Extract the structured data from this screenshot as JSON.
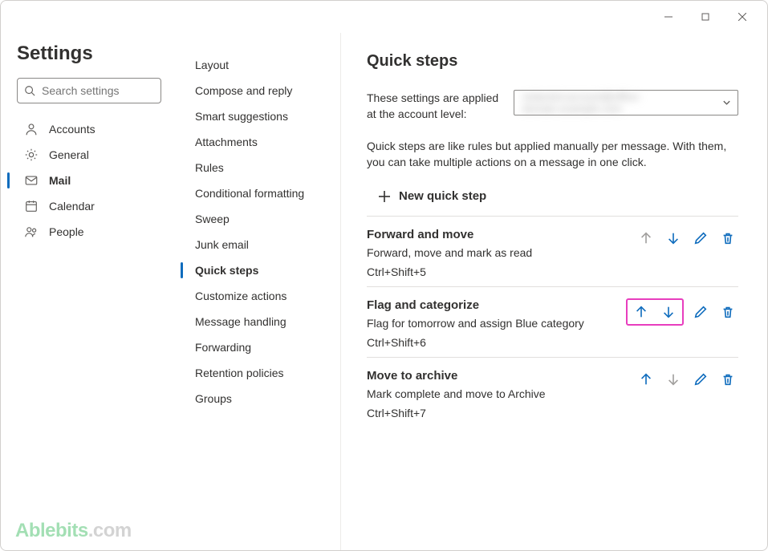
{
  "window": {
    "minimize": "Minimize",
    "maximize": "Maximize",
    "close": "Close"
  },
  "leftCol": {
    "title": "Settings",
    "searchPlaceholder": "Search settings",
    "nav": [
      {
        "key": "accounts",
        "label": "Accounts",
        "icon": "person"
      },
      {
        "key": "general",
        "label": "General",
        "icon": "gear"
      },
      {
        "key": "mail",
        "label": "Mail",
        "icon": "mail",
        "selected": true
      },
      {
        "key": "calendar",
        "label": "Calendar",
        "icon": "calendar"
      },
      {
        "key": "people",
        "label": "People",
        "icon": "people"
      }
    ]
  },
  "midCol": {
    "items": [
      "Layout",
      "Compose and reply",
      "Smart suggestions",
      "Attachments",
      "Rules",
      "Conditional formatting",
      "Sweep",
      "Junk email",
      "Quick steps",
      "Customize actions",
      "Message handling",
      "Forwarding",
      "Retention policies",
      "Groups"
    ],
    "selectedIndex": 8
  },
  "rightCol": {
    "title": "Quick steps",
    "appliedLabel": "These settings are applied at the account level:",
    "accountObscured": "redacted.account@office-domain.example.com",
    "description": "Quick steps are like rules but applied manually per message. With them, you can take multiple actions on a message in one click.",
    "newStepLabel": "New quick step",
    "steps": [
      {
        "title": "Forward and move",
        "desc": "Forward, move and mark as read",
        "shortcut": "Ctrl+Shift+5",
        "upEnabled": false,
        "downEnabled": true,
        "highlightArrows": false
      },
      {
        "title": "Flag and categorize",
        "desc": "Flag for tomorrow and assign Blue category",
        "shortcut": "Ctrl+Shift+6",
        "upEnabled": true,
        "downEnabled": true,
        "highlightArrows": true
      },
      {
        "title": "Move to archive",
        "desc": "Mark complete and move to Archive",
        "shortcut": "Ctrl+Shift+7",
        "upEnabled": true,
        "downEnabled": false,
        "highlightArrows": false
      }
    ]
  },
  "watermark": {
    "brand": "Ablebits",
    "suffix": ".com"
  }
}
